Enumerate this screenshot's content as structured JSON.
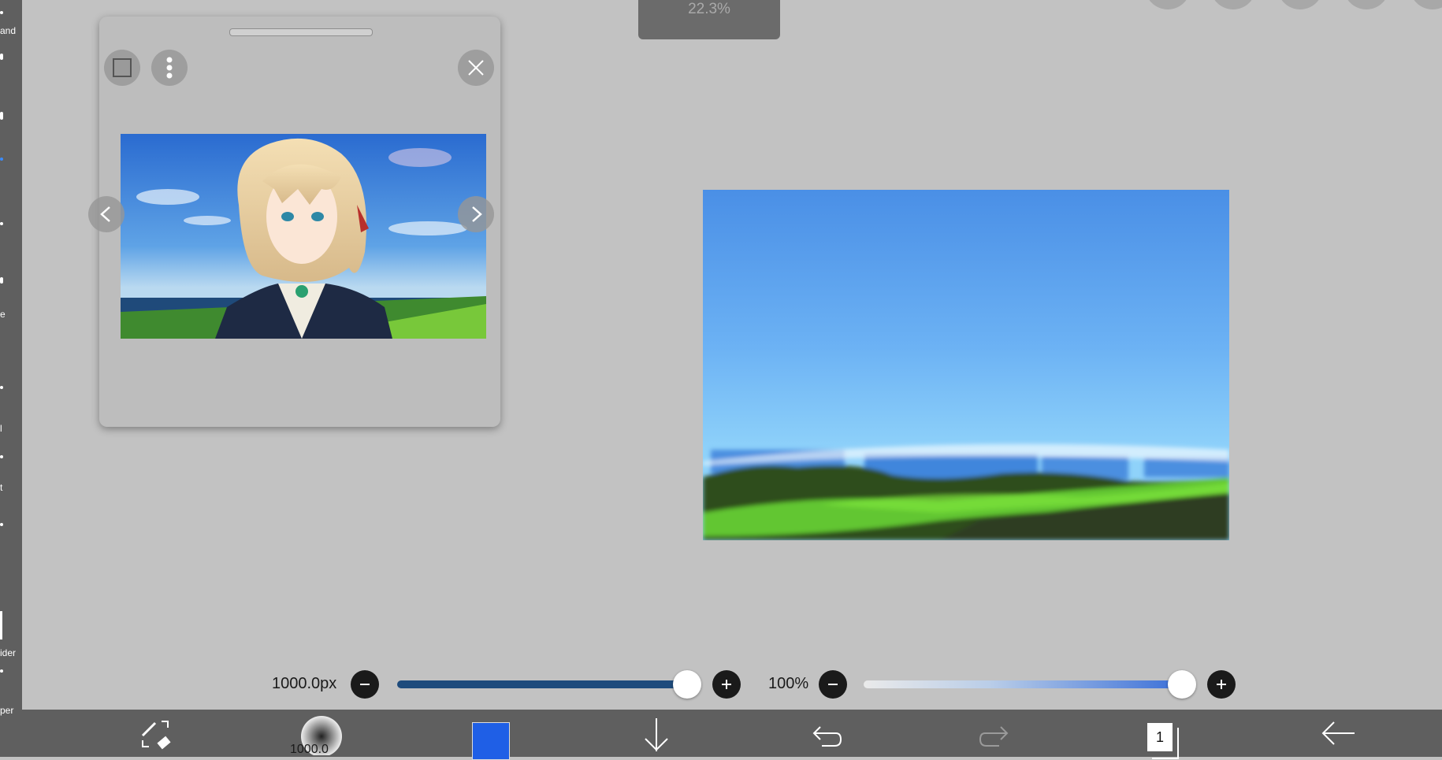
{
  "zoom": {
    "label": "22.3%"
  },
  "sidebar": {
    "labels": [
      "and",
      "e",
      "l",
      "t",
      "ider",
      "per"
    ]
  },
  "reference_window": {
    "buttons": [
      "select-frame",
      "more-options",
      "close"
    ],
    "image_description": "anime character portrait"
  },
  "brush_slider": {
    "value_label": "1000.0px",
    "fraction": 1.0,
    "track_color": "#1e4b7c"
  },
  "opacity_slider": {
    "value_label": "100%",
    "fraction": 1.0,
    "track_color": "#3a6fd8"
  },
  "toolbar": {
    "brush_size_label": "1000.0",
    "color_swatch": "#1f5fe6",
    "layer_count": "1"
  }
}
